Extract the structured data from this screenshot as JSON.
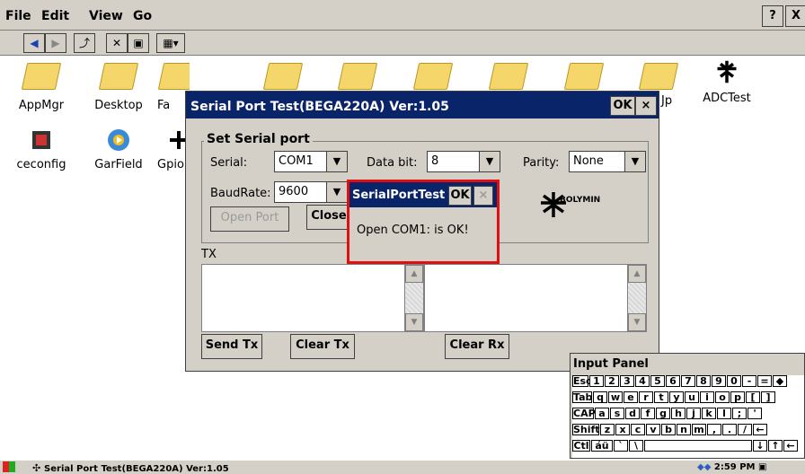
{
  "menubar": {
    "items": [
      "File",
      "Edit",
      "View",
      "Go"
    ],
    "help": "?",
    "close": "X"
  },
  "toolbar": {
    "icons": [
      "back-icon",
      "forward-icon",
      "up-folder-icon",
      "delete-icon",
      "properties-icon",
      "views-icon"
    ]
  },
  "desktop": {
    "row1": [
      "AppMgr",
      "Desktop",
      "Fa",
      "",
      "",
      "",
      "",
      "",
      "Jp",
      "ADCTest"
    ],
    "row2": [
      "ceconfig",
      "GarField",
      "Gpio"
    ]
  },
  "main_window": {
    "title": "Serial Port Test(BEGA220A)  Ver:1.05",
    "ok": "OK",
    "close": "×",
    "group_title": "Set Serial port",
    "serial_label": "Serial:",
    "serial_value": "COM1",
    "databit_label": "Data bit:",
    "databit_value": "8",
    "parity_label": "Parity:",
    "parity_value": "None",
    "baud_label": "BaudRate:",
    "baud_value": "9600",
    "open_port": "Open Port",
    "close_port": "Close",
    "logo_text": "BOLYMIN",
    "tx_label": "TX",
    "send_tx": "Send Tx",
    "clear_tx": "Clear Tx",
    "clear_rx": "Clear Rx"
  },
  "msgbox": {
    "title": "SerialPortTest",
    "ok": "OK",
    "close": "×",
    "message": "Open COM1: is OK!"
  },
  "input_panel": {
    "title": "Input Panel",
    "row1": [
      "Esc",
      "1",
      "2",
      "3",
      "4",
      "5",
      "6",
      "7",
      "8",
      "9",
      "0",
      "-",
      "=",
      "◆"
    ],
    "row2": [
      "Tab",
      "q",
      "w",
      "e",
      "r",
      "t",
      "y",
      "u",
      "i",
      "o",
      "p",
      "[",
      "]"
    ],
    "row3": [
      "CAP",
      "a",
      "s",
      "d",
      "f",
      "g",
      "h",
      "j",
      "k",
      "l",
      ";",
      "'"
    ],
    "row4": [
      "Shift",
      "z",
      "x",
      "c",
      "v",
      "b",
      "n",
      "m",
      ",",
      ".",
      "/",
      "←"
    ],
    "row5": [
      "Ctl",
      "áü",
      "`",
      "\\",
      "",
      "↓",
      "↑",
      "←"
    ]
  },
  "taskbar": {
    "task": "Serial Port Test(BEGA220A)  Ver:1.05",
    "clock": "2:59 PM"
  }
}
